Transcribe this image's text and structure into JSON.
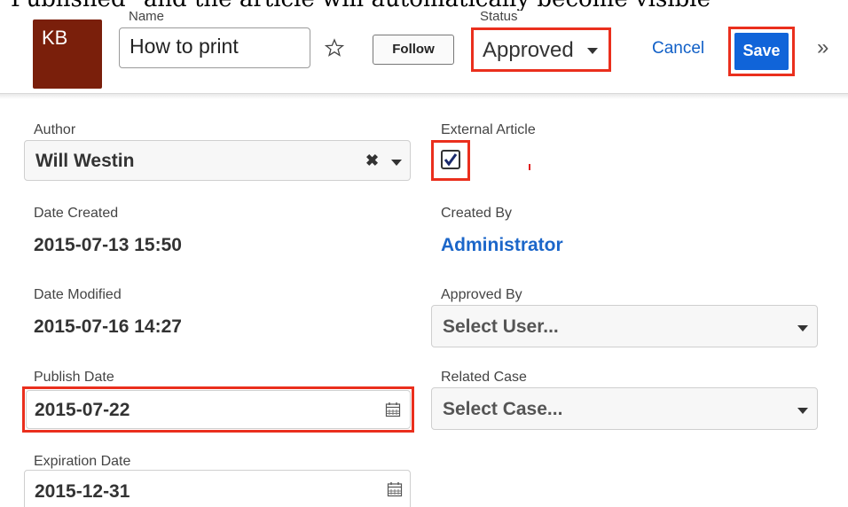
{
  "caption": "\"Published\" and the article will automatically become visible",
  "header": {
    "avatar_text": "KB",
    "name_label": "Name",
    "name_value": "How to print",
    "follow_label": "Follow",
    "status_label": "Status",
    "status_value": "Approved",
    "cancel_label": "Cancel",
    "save_label": "Save",
    "more_icon": "»"
  },
  "fields": {
    "author": {
      "label": "Author",
      "value": "Will Westin"
    },
    "external_article": {
      "label": "External Article",
      "checked": true
    },
    "date_created": {
      "label": "Date Created",
      "value": "2015-07-13 15:50"
    },
    "created_by": {
      "label": "Created By",
      "value": "Administrator"
    },
    "date_modified": {
      "label": "Date Modified",
      "value": "2015-07-16 14:27"
    },
    "approved_by": {
      "label": "Approved By",
      "placeholder": "Select User..."
    },
    "publish_date": {
      "label": "Publish Date",
      "value": "2015-07-22"
    },
    "related_case": {
      "label": "Related Case",
      "placeholder": "Select Case..."
    },
    "expiration_date": {
      "label": "Expiration Date",
      "value": "2015-12-31"
    }
  },
  "colors": {
    "avatar_bg": "#7a1f0b",
    "highlight": "#ea2f1d",
    "primary": "#1064d9",
    "link": "#1b66c9"
  }
}
